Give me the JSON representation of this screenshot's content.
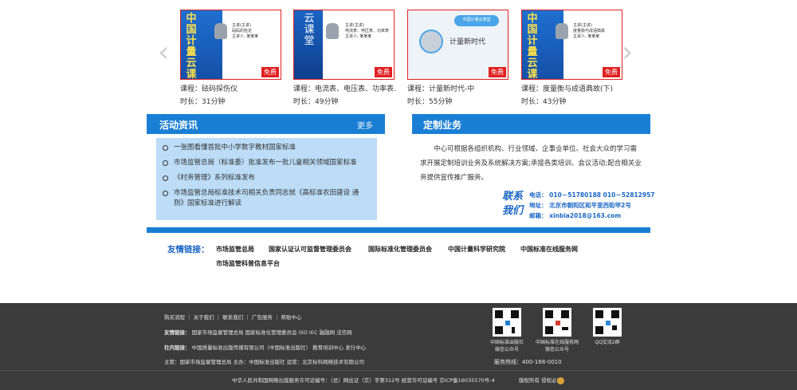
{
  "carousel": {
    "prev_icon": "chevron-left-icon",
    "next_icon": "chevron-right-icon",
    "courses": [
      {
        "vertical_text": "中国计量云课堂",
        "thumb_info": "主讲(主讲)\n砝码的检定\n主讲人: 某某某",
        "free_label": "免费",
        "title": "课程：砝码探伤仪",
        "duration": "时长：31分钟"
      },
      {
        "vertical_text": "云课堂",
        "thumb_info": "主讲(主讲)\n电流表、电压表、功率表\n主讲人: 某某某",
        "free_label": "免费",
        "title": "课程：电流表、电压表、功率表...",
        "duration": "时长：49分钟"
      },
      {
        "cloud_text": "中国计量云课堂",
        "big_text": "计量新时代",
        "free_label": "免费",
        "title": "课程：计量新时代-中",
        "duration": "时长：55分钟"
      },
      {
        "vertical_text": "中国计量云课堂",
        "thumb_info": "主讲(主讲)\n度量衡与成语典故\n主讲人: 某某某",
        "free_label": "免费",
        "title": "课程：度量衡与成语典故(下)",
        "duration": "时长：43分钟"
      }
    ]
  },
  "news": {
    "title": "活动资讯",
    "more": "更多",
    "items": [
      "一张图看懂首批中小学数字教材国家标准",
      "市场监管总局（标准委）批准发布一批儿童相关领域国家标准",
      "《村务管理》系列标准发布",
      "市场监管总局标准技术司相关负责同志就《高标准农田建设 通则》国家标准进行解读"
    ]
  },
  "business": {
    "title": "定制业务",
    "description": "中心可根据各组织机构、行业领域、企事业单位、社会大众的学习需求开展定制培训业务及系统解决方案;承接各类培训、会议活动;配合相关业务提供宣传推广服务。",
    "contact_label_1": "联系",
    "contact_label_2": "我们",
    "phone": "电话： 010－51780188   010－52812957",
    "address": "地址： 北京市朝阳区和平里西街甲2号",
    "email": "邮箱： xinbia2018@163.com"
  },
  "links": {
    "label": "友情链接：",
    "items": [
      "市场监管总局",
      "国家认证认可监督管理委员会",
      "国际标准化管理委员会",
      "中国计量科学研究院",
      "中国标准在线服务网",
      "市场监管科普信息平台"
    ]
  },
  "footer": {
    "nav": "购买流程  ｜  关于我们  ｜  联系我们  ｜  广告服务  ｜  帮助中心",
    "friend_label": "友情链接：",
    "friend_links": "国家市场监督管理总局      国家标准化管理委员会      ISO      IEC      融融网      法信网",
    "internal_label": "社内链接：",
    "internal_links": "中国质量标准出版传媒有限公司（中国标准出版社）      教育培训中心      发行中心",
    "sponsor": "主管：国家市场监督管理总局      主办：中国标准出版社      运营：北京标科网络技术有限公司",
    "qr_codes": [
      {
        "caption_1": "中国标准出版社",
        "caption_2": "微信公众号"
      },
      {
        "caption_1": "中国标准在线服务网",
        "caption_2": "微信公众号"
      },
      {
        "caption_1": "QQ交流2群",
        "caption_2": ""
      }
    ],
    "hotline": "服务热线：400-168-0010",
    "license": "中华人民共和国网络出版服务许可证编号：（总）网出证（京）字第312号      经营许可证编号 京ICP备16035570号-4",
    "rights": "版权所有 侵权必究"
  }
}
